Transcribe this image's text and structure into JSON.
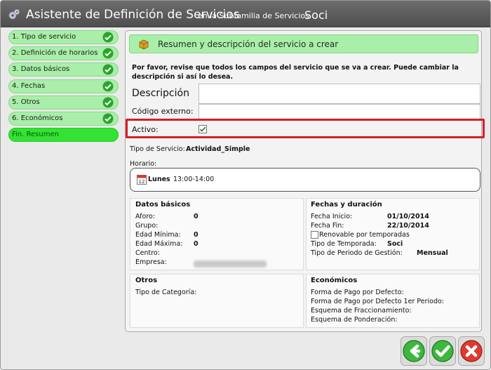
{
  "window": {
    "title": "Asistente de Definición de Servicios",
    "subtitle": "en la Subfamilia de Servicios",
    "subfamily": "Soci"
  },
  "steps": [
    {
      "label": "1. Tipo de servicio",
      "done": true
    },
    {
      "label": "2. Definición de horarios",
      "done": true
    },
    {
      "label": "3. Datos básicos",
      "done": true
    },
    {
      "label": "4. Fechas",
      "done": true
    },
    {
      "label": "5. Otros",
      "done": true
    },
    {
      "label": "6. Económicos",
      "done": true
    },
    {
      "label": "Fin. Resumen",
      "done": false,
      "active": true
    }
  ],
  "panel": {
    "header": "Resumen y descripción del servicio a crear",
    "intro": "Por favor, revise que todos los campos del servicio que se va a crear. Puede cambiar la descripción si así lo desea."
  },
  "form": {
    "descripcion_label": "Descripción",
    "descripcion_value": "",
    "codigo_label": "Código externo:",
    "codigo_value": "",
    "activo_label": "Activo:",
    "activo_checked": true
  },
  "summary": {
    "tipo_label": "Tipo de Servicio:",
    "tipo_value": "Actividad_Simple",
    "horario_label": "Horario:",
    "horario_day": "Lunes",
    "horario_time": "13:00-14:00"
  },
  "datos_basicos": {
    "title": "Datos básicos",
    "aforo_label": "Aforo:",
    "aforo_value": "0",
    "grupo_label": "Grupo:",
    "grupo_value": "",
    "edad_min_label": "Edad Mínima:",
    "edad_min_value": "0",
    "edad_max_label": "Edad Máxima:",
    "edad_max_value": "0",
    "centro_label": "Centro:",
    "centro_value": "",
    "empresa_label": "Empresa:"
  },
  "fechas": {
    "title": "Fechas y duración",
    "inicio_label": "Fecha Inicio:",
    "inicio_value": "01/10/2014",
    "fin_label": "Fecha Fin:",
    "fin_value": "22/10/2014",
    "renovable_label": "Renovable por temporadas",
    "renovable_checked": false,
    "temporada_label": "Tipo de Temporada:",
    "temporada_value": "Soci",
    "periodo_label": "Tipo de Periodo de Gestión:",
    "periodo_value": "Mensual"
  },
  "otros": {
    "title": "Otros",
    "categoria_label": "Tipo de Categoría:"
  },
  "economicos": {
    "title": "Económicos",
    "forma_pago_label": "Forma de Pago por Defecto:",
    "forma_pago_1er_label": "Forma de Pago por Defecto 1er Periodo:",
    "fraccionamiento_label": "Esquema de Fraccionamiento:",
    "ponderacion_label": "Esquema de Ponderación:"
  },
  "colors": {
    "step_bg": "#a9eea9",
    "step_active_bg": "#33e233",
    "highlight": "#d61f26",
    "title_bar": "#5a5a5a"
  },
  "icons": {
    "back": "back-arrow-icon",
    "accept": "checkmark-icon",
    "cancel": "close-icon"
  }
}
